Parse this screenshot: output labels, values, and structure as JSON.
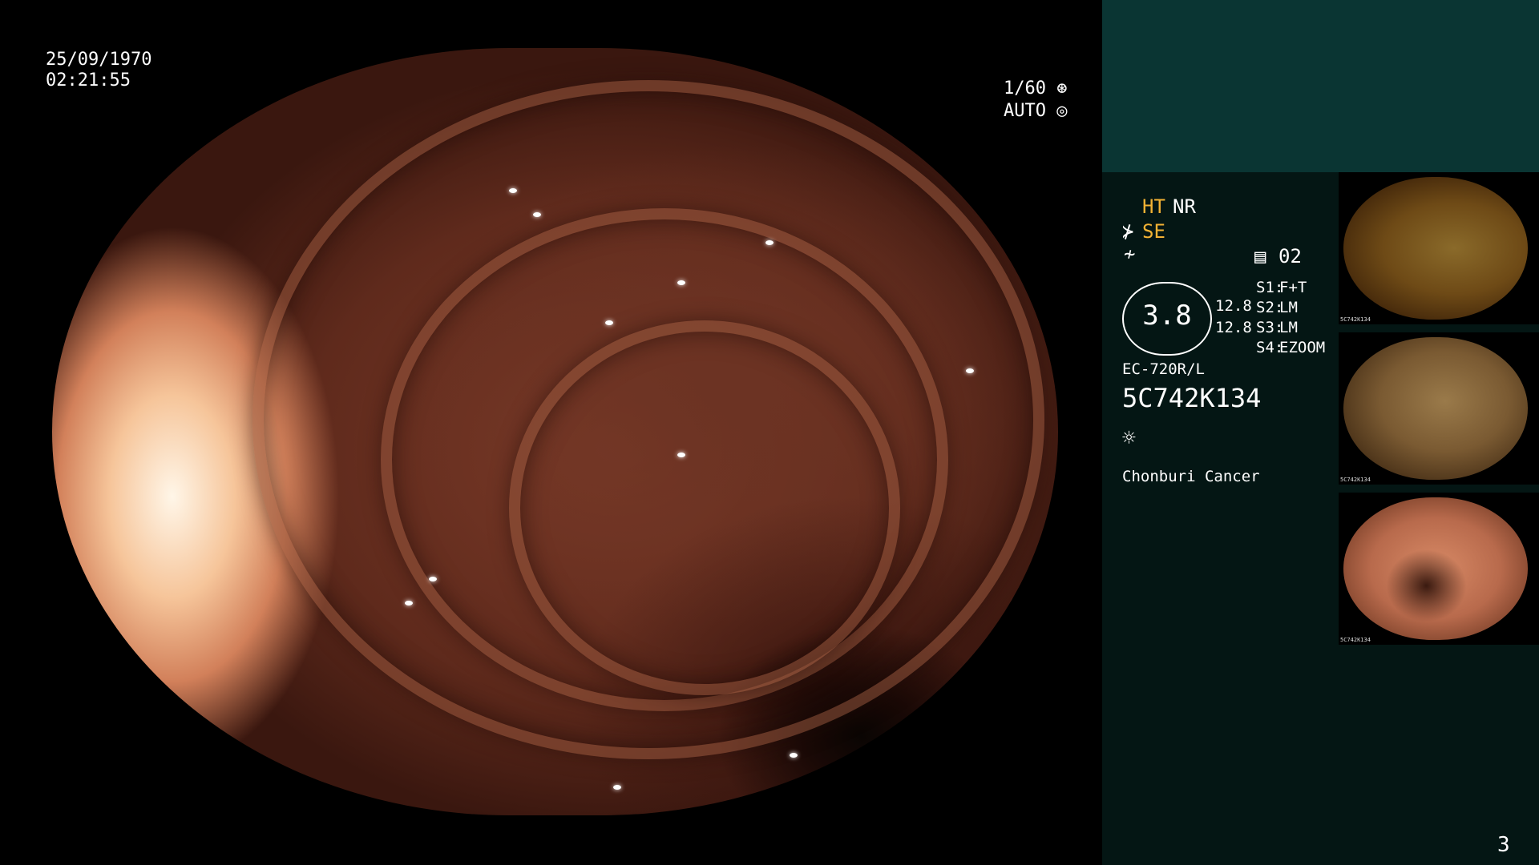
{
  "main_view": {
    "date": "25/09/1970",
    "time": "02:21:55",
    "shutter": "1/60",
    "exposure": "AUTO"
  },
  "side_panel": {
    "mode_ht": "HT",
    "mode_nr": "NR",
    "mode_se": "SE",
    "memory_index": "02",
    "magnification": "3.8",
    "mag_value_1": "12.8",
    "mag_value_2": "12.8",
    "switch_labels": [
      "S1:",
      "S2:",
      "S3:",
      "S4:"
    ],
    "switch_values": [
      "F+T",
      "LM",
      "LM",
      "EZOOM"
    ],
    "scope_model": "EC-720R/L",
    "serial": "5C742K134",
    "institution": "Chonburi Cancer",
    "page_number": "3"
  },
  "thumbnails": [
    {
      "caption": "5C742K134",
      "tone": "#6e4a16"
    },
    {
      "caption": "5C742K134",
      "tone": "#7a5a32"
    },
    {
      "caption": "5C742K134",
      "tone": "#b86a4c"
    }
  ]
}
